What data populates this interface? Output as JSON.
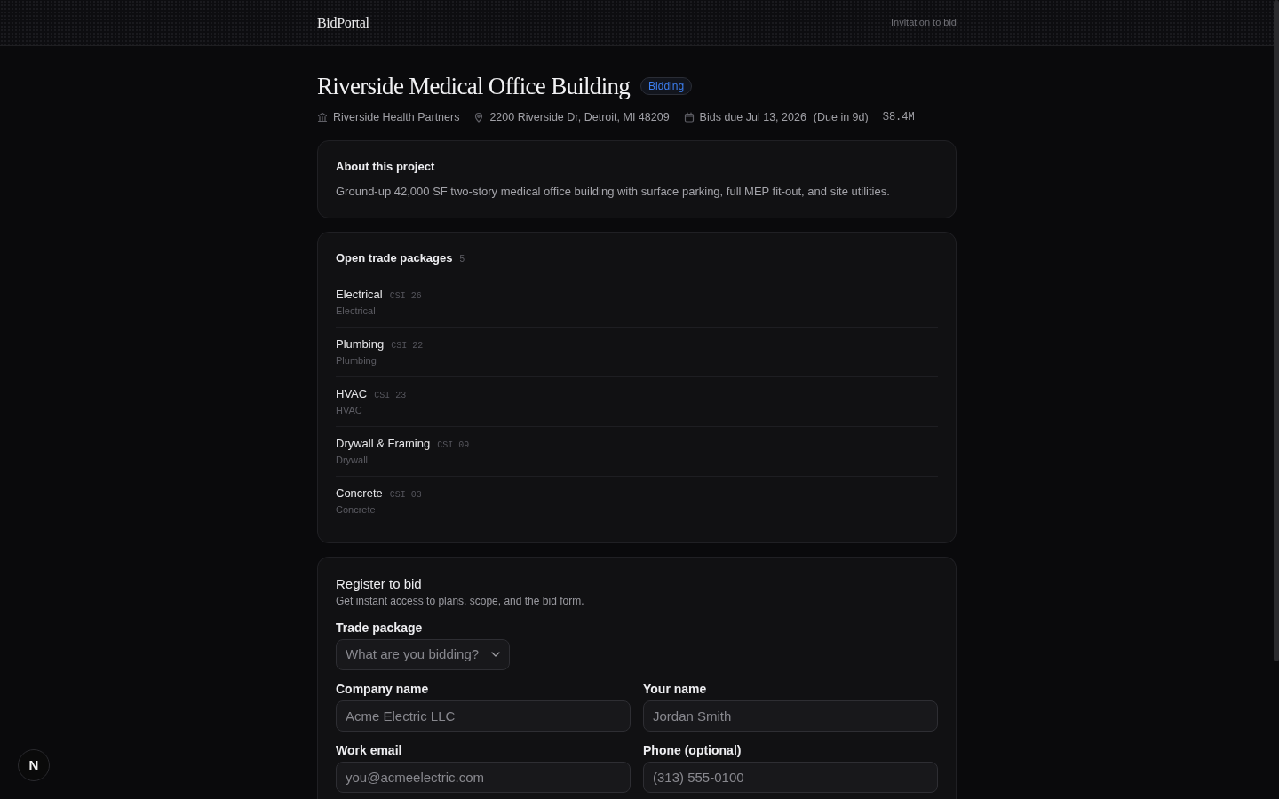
{
  "header": {
    "brand": "BidPortal",
    "context": "Invitation to bid"
  },
  "project": {
    "title": "Riverside Medical Office Building",
    "status": "Bidding",
    "owner": "Riverside Health Partners",
    "address": "2200 Riverside Dr, Detroit, MI 48209",
    "due": "Bids due Jul 13, 2026",
    "due_relative": "(Due in 9d)",
    "value": "$8.4M"
  },
  "about": {
    "heading": "About this project",
    "description": "Ground-up 42,000 SF two-story medical office building with surface parking, full MEP fit-out, and site utilities."
  },
  "trade_packages": {
    "heading": "Open trade packages",
    "count": "5",
    "items": [
      {
        "name": "Electrical",
        "csi": "CSI 26",
        "category": "Electrical"
      },
      {
        "name": "Plumbing",
        "csi": "CSI 22",
        "category": "Plumbing"
      },
      {
        "name": "HVAC",
        "csi": "CSI 23",
        "category": "HVAC"
      },
      {
        "name": "Drywall & Framing",
        "csi": "CSI 09",
        "category": "Drywall"
      },
      {
        "name": "Concrete",
        "csi": "CSI 03",
        "category": "Concrete"
      }
    ]
  },
  "register": {
    "heading": "Register to bid",
    "subtitle": "Get instant access to plans, scope, and the bid form.",
    "fields": [
      {
        "kind": "select",
        "label": "Trade package",
        "placeholder": "What are you bidding?"
      },
      {
        "kind": "text",
        "label": "Company name",
        "placeholder": "Acme Electric LLC"
      },
      {
        "kind": "text",
        "label": "Your name",
        "placeholder": "Jordan Smith"
      },
      {
        "kind": "text",
        "label": "Work email",
        "placeholder": "you@acmeelectric.com"
      },
      {
        "kind": "text",
        "label": "Phone (optional)",
        "placeholder": "(313) 555-0100"
      }
    ]
  },
  "dev_badge": {
    "label": "N"
  }
}
